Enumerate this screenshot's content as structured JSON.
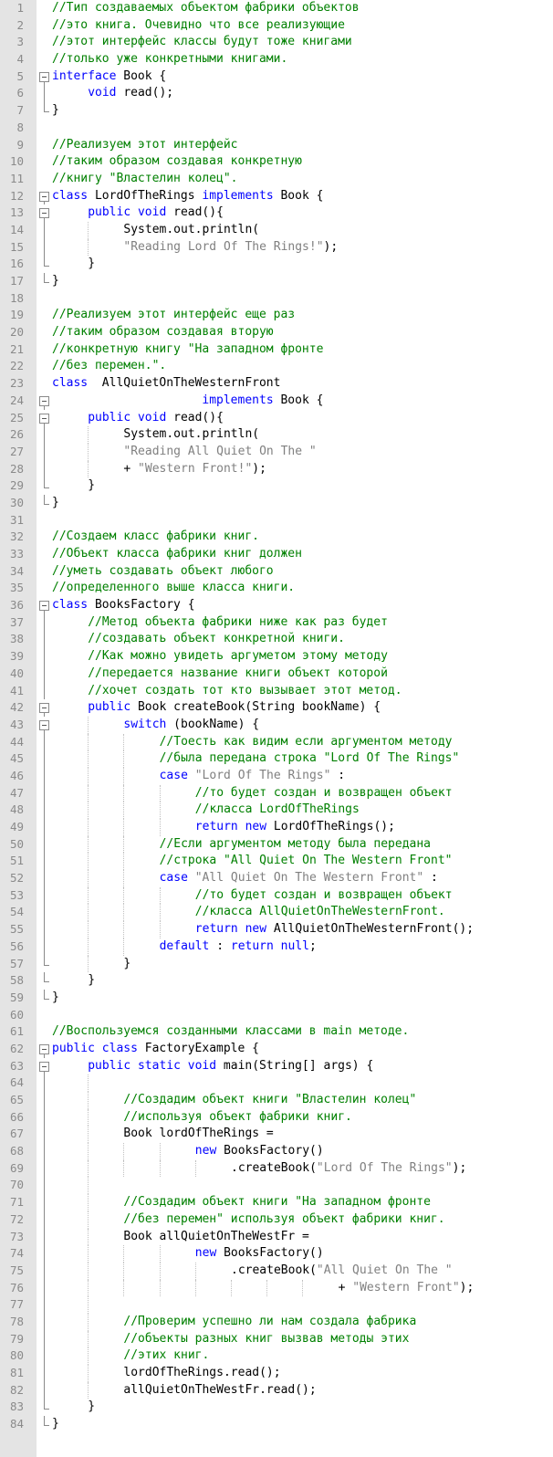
{
  "colors": {
    "comment": "#008000",
    "keyword": "#0000ff",
    "type": "#8000ff",
    "string": "#808080",
    "plain": "#000000",
    "line_number": "#8a8a8a",
    "gutter_background": "#e4e4e4"
  },
  "lines": [
    {
      "n": "1",
      "indent": 0,
      "fold": "none",
      "tokens": [
        [
          "comment",
          "//Тип создаваемых объектом фабрики объектов"
        ]
      ]
    },
    {
      "n": "2",
      "indent": 0,
      "fold": "none",
      "tokens": [
        [
          "comment",
          "//это книга. Очевидно что все реализующие"
        ]
      ]
    },
    {
      "n": "3",
      "indent": 0,
      "fold": "none",
      "tokens": [
        [
          "comment",
          "//этот интерфейс классы будут тоже книгами"
        ]
      ]
    },
    {
      "n": "4",
      "indent": 0,
      "fold": "none",
      "tokens": [
        [
          "comment",
          "//только уже конкретными книгами."
        ]
      ]
    },
    {
      "n": "5",
      "indent": 0,
      "fold": "open",
      "tokens": [
        [
          "keyword",
          "interface"
        ],
        [
          "plain",
          " Book {"
        ]
      ]
    },
    {
      "n": "6",
      "indent": 1,
      "fold": "mid",
      "tokens": [
        [
          "keyword",
          "void"
        ],
        [
          "plain",
          " read();"
        ]
      ]
    },
    {
      "n": "7",
      "indent": 0,
      "fold": "close",
      "tokens": [
        [
          "plain",
          "}"
        ]
      ]
    },
    {
      "n": "8",
      "indent": 0,
      "fold": "none",
      "tokens": []
    },
    {
      "n": "9",
      "indent": 0,
      "fold": "none",
      "tokens": [
        [
          "comment",
          "//Реализуем этот интерфейс"
        ]
      ]
    },
    {
      "n": "10",
      "indent": 0,
      "fold": "none",
      "tokens": [
        [
          "comment",
          "//таким образом создавая конкретную"
        ]
      ]
    },
    {
      "n": "11",
      "indent": 0,
      "fold": "none",
      "tokens": [
        [
          "comment",
          "//книгу \"Властелин колец\"."
        ]
      ]
    },
    {
      "n": "12",
      "indent": 0,
      "fold": "open",
      "tokens": [
        [
          "keyword",
          "class"
        ],
        [
          "plain",
          " LordOfTheRings "
        ],
        [
          "keyword",
          "implements"
        ],
        [
          "plain",
          " Book {"
        ]
      ]
    },
    {
      "n": "13",
      "indent": 1,
      "fold": "open",
      "tokens": [
        [
          "keyword",
          "public"
        ],
        [
          "plain",
          " "
        ],
        [
          "keyword",
          "void"
        ],
        [
          "plain",
          " read(){"
        ]
      ]
    },
    {
      "n": "14",
      "indent": 2,
      "fold": "mid",
      "tokens": [
        [
          "plain",
          "System.out.println("
        ]
      ]
    },
    {
      "n": "15",
      "indent": 2,
      "fold": "mid",
      "tokens": [
        [
          "string",
          "\"Reading Lord Of The Rings!\""
        ],
        [
          "plain",
          ");"
        ]
      ]
    },
    {
      "n": "16",
      "indent": 1,
      "fold": "close",
      "tokens": [
        [
          "plain",
          "}"
        ]
      ]
    },
    {
      "n": "17",
      "indent": 0,
      "fold": "close",
      "tokens": [
        [
          "plain",
          "}"
        ]
      ]
    },
    {
      "n": "18",
      "indent": 0,
      "fold": "none",
      "tokens": []
    },
    {
      "n": "19",
      "indent": 0,
      "fold": "none",
      "tokens": [
        [
          "comment",
          "//Реализуем этот интерфейс еще раз"
        ]
      ]
    },
    {
      "n": "20",
      "indent": 0,
      "fold": "none",
      "tokens": [
        [
          "comment",
          "//таким образом создавая вторую"
        ]
      ]
    },
    {
      "n": "21",
      "indent": 0,
      "fold": "none",
      "tokens": [
        [
          "comment",
          "//конкретную книгу \"На западном фронте"
        ]
      ]
    },
    {
      "n": "22",
      "indent": 0,
      "fold": "none",
      "tokens": [
        [
          "comment",
          "//без перемен.\"."
        ]
      ]
    },
    {
      "n": "23",
      "indent": 0,
      "fold": "none",
      "tokens": [
        [
          "keyword",
          "class"
        ],
        [
          "plain",
          "  AllQuietOnTheWesternFront"
        ]
      ]
    },
    {
      "n": "24",
      "indent": 0,
      "fold": "open",
      "tokens": [
        [
          "plain",
          "                     "
        ],
        [
          "keyword",
          "implements"
        ],
        [
          "plain",
          " Book {"
        ]
      ]
    },
    {
      "n": "25",
      "indent": 1,
      "fold": "open",
      "tokens": [
        [
          "keyword",
          "public"
        ],
        [
          "plain",
          " "
        ],
        [
          "keyword",
          "void"
        ],
        [
          "plain",
          " read(){"
        ]
      ]
    },
    {
      "n": "26",
      "indent": 2,
      "fold": "mid",
      "tokens": [
        [
          "plain",
          "System.out.println("
        ]
      ]
    },
    {
      "n": "27",
      "indent": 2,
      "fold": "mid",
      "tokens": [
        [
          "string",
          "\"Reading All Quiet On The \""
        ]
      ]
    },
    {
      "n": "28",
      "indent": 2,
      "fold": "mid",
      "tokens": [
        [
          "plain",
          "+ "
        ],
        [
          "string",
          "\"Western Front!\""
        ],
        [
          "plain",
          ");"
        ]
      ]
    },
    {
      "n": "29",
      "indent": 1,
      "fold": "close",
      "tokens": [
        [
          "plain",
          "}"
        ]
      ]
    },
    {
      "n": "30",
      "indent": 0,
      "fold": "close",
      "tokens": [
        [
          "plain",
          "}"
        ]
      ]
    },
    {
      "n": "31",
      "indent": 0,
      "fold": "none",
      "tokens": []
    },
    {
      "n": "32",
      "indent": 0,
      "fold": "none",
      "tokens": [
        [
          "comment",
          "//Создаем класс фабрики книг."
        ]
      ]
    },
    {
      "n": "33",
      "indent": 0,
      "fold": "none",
      "tokens": [
        [
          "comment",
          "//Объект класса фабрики книг должен"
        ]
      ]
    },
    {
      "n": "34",
      "indent": 0,
      "fold": "none",
      "tokens": [
        [
          "comment",
          "//уметь создавать объект любого"
        ]
      ]
    },
    {
      "n": "35",
      "indent": 0,
      "fold": "none",
      "tokens": [
        [
          "comment",
          "//определенного выше класса книги."
        ]
      ]
    },
    {
      "n": "36",
      "indent": 0,
      "fold": "open",
      "tokens": [
        [
          "keyword",
          "class"
        ],
        [
          "plain",
          " BooksFactory {"
        ]
      ]
    },
    {
      "n": "37",
      "indent": 1,
      "fold": "mid",
      "tokens": [
        [
          "comment",
          "//Метод объекта фабрики ниже как раз будет"
        ]
      ]
    },
    {
      "n": "38",
      "indent": 1,
      "fold": "mid",
      "tokens": [
        [
          "comment",
          "//создавать объект конкретной книги."
        ]
      ]
    },
    {
      "n": "39",
      "indent": 1,
      "fold": "mid",
      "tokens": [
        [
          "comment",
          "//Как можно увидеть аргуметом этому методу"
        ]
      ]
    },
    {
      "n": "40",
      "indent": 1,
      "fold": "mid",
      "tokens": [
        [
          "comment",
          "//передается название книги объект которой"
        ]
      ]
    },
    {
      "n": "41",
      "indent": 1,
      "fold": "mid",
      "tokens": [
        [
          "comment",
          "//хочет создать тот кто вызывает этот метод."
        ]
      ]
    },
    {
      "n": "42",
      "indent": 1,
      "fold": "open",
      "tokens": [
        [
          "keyword",
          "public"
        ],
        [
          "plain",
          " Book createBook(String bookName) {"
        ]
      ]
    },
    {
      "n": "43",
      "indent": 2,
      "fold": "open",
      "tokens": [
        [
          "keyword",
          "switch"
        ],
        [
          "plain",
          " (bookName) {"
        ]
      ]
    },
    {
      "n": "44",
      "indent": 3,
      "fold": "mid",
      "tokens": [
        [
          "comment",
          "//Тоесть как видим если аргументом методу"
        ]
      ]
    },
    {
      "n": "45",
      "indent": 3,
      "fold": "mid",
      "tokens": [
        [
          "comment",
          "//была передана строка \"Lord Of The Rings\""
        ]
      ]
    },
    {
      "n": "46",
      "indent": 3,
      "fold": "mid",
      "tokens": [
        [
          "keyword",
          "case"
        ],
        [
          "plain",
          " "
        ],
        [
          "string",
          "\"Lord Of The Rings\""
        ],
        [
          "plain",
          " :"
        ]
      ]
    },
    {
      "n": "47",
      "indent": 4,
      "fold": "mid",
      "tokens": [
        [
          "comment",
          "//то будет создан и возвращен объект"
        ]
      ]
    },
    {
      "n": "48",
      "indent": 4,
      "fold": "mid",
      "tokens": [
        [
          "comment",
          "//класса LordOfTheRings"
        ]
      ]
    },
    {
      "n": "49",
      "indent": 4,
      "fold": "mid",
      "tokens": [
        [
          "keyword",
          "return"
        ],
        [
          "plain",
          " "
        ],
        [
          "keyword",
          "new"
        ],
        [
          "plain",
          " LordOfTheRings();"
        ]
      ]
    },
    {
      "n": "50",
      "indent": 3,
      "fold": "mid",
      "tokens": [
        [
          "comment",
          "//Если аргументом методу была передана"
        ]
      ]
    },
    {
      "n": "51",
      "indent": 3,
      "fold": "mid",
      "tokens": [
        [
          "comment",
          "//строка \"All Quiet On The Western Front\""
        ]
      ]
    },
    {
      "n": "52",
      "indent": 3,
      "fold": "mid",
      "tokens": [
        [
          "keyword",
          "case"
        ],
        [
          "plain",
          " "
        ],
        [
          "string",
          "\"All Quiet On The Western Front\""
        ],
        [
          "plain",
          " :"
        ]
      ]
    },
    {
      "n": "53",
      "indent": 4,
      "fold": "mid",
      "tokens": [
        [
          "comment",
          "//то будет создан и возвращен объект"
        ]
      ]
    },
    {
      "n": "54",
      "indent": 4,
      "fold": "mid",
      "tokens": [
        [
          "comment",
          "//класса AllQuietOnTheWesternFront."
        ]
      ]
    },
    {
      "n": "55",
      "indent": 4,
      "fold": "mid",
      "tokens": [
        [
          "keyword",
          "return"
        ],
        [
          "plain",
          " "
        ],
        [
          "keyword",
          "new"
        ],
        [
          "plain",
          " AllQuietOnTheWesternFront();"
        ]
      ]
    },
    {
      "n": "56",
      "indent": 3,
      "fold": "mid",
      "tokens": [
        [
          "keyword",
          "default"
        ],
        [
          "plain",
          " : "
        ],
        [
          "keyword",
          "return"
        ],
        [
          "plain",
          " "
        ],
        [
          "keyword",
          "null"
        ],
        [
          "plain",
          ";"
        ]
      ]
    },
    {
      "n": "57",
      "indent": 2,
      "fold": "close",
      "tokens": [
        [
          "plain",
          "}"
        ]
      ]
    },
    {
      "n": "58",
      "indent": 1,
      "fold": "close",
      "tokens": [
        [
          "plain",
          "}"
        ]
      ]
    },
    {
      "n": "59",
      "indent": 0,
      "fold": "close",
      "tokens": [
        [
          "plain",
          "}"
        ]
      ]
    },
    {
      "n": "60",
      "indent": 0,
      "fold": "none",
      "tokens": []
    },
    {
      "n": "61",
      "indent": 0,
      "fold": "none",
      "tokens": [
        [
          "comment",
          "//Воспользуемся созданными классами в main методе."
        ]
      ]
    },
    {
      "n": "62",
      "indent": 0,
      "fold": "open",
      "tokens": [
        [
          "keyword",
          "public"
        ],
        [
          "plain",
          " "
        ],
        [
          "keyword",
          "class"
        ],
        [
          "plain",
          " FactoryExample {"
        ]
      ]
    },
    {
      "n": "63",
      "indent": 1,
      "fold": "open",
      "tokens": [
        [
          "keyword",
          "public"
        ],
        [
          "plain",
          " "
        ],
        [
          "keyword",
          "static"
        ],
        [
          "plain",
          " "
        ],
        [
          "keyword",
          "void"
        ],
        [
          "plain",
          " main(String[] args) {"
        ]
      ]
    },
    {
      "n": "64",
      "indent": 2,
      "fold": "mid",
      "tokens": []
    },
    {
      "n": "65",
      "indent": 2,
      "fold": "mid",
      "tokens": [
        [
          "comment",
          "//Создадим объект книги \"Властелин колец\""
        ]
      ]
    },
    {
      "n": "66",
      "indent": 2,
      "fold": "mid",
      "tokens": [
        [
          "comment",
          "//используя объект фабрики книг."
        ]
      ]
    },
    {
      "n": "67",
      "indent": 2,
      "fold": "mid",
      "tokens": [
        [
          "plain",
          "Book lordOfTheRings ="
        ]
      ]
    },
    {
      "n": "68",
      "indent": 4,
      "fold": "mid",
      "tokens": [
        [
          "keyword",
          "new"
        ],
        [
          "plain",
          " BooksFactory()"
        ]
      ]
    },
    {
      "n": "69",
      "indent": 5,
      "fold": "mid",
      "tokens": [
        [
          "plain",
          ".createBook("
        ],
        [
          "string",
          "\"Lord Of The Rings\""
        ],
        [
          "plain",
          ");"
        ]
      ]
    },
    {
      "n": "70",
      "indent": 2,
      "fold": "mid",
      "tokens": []
    },
    {
      "n": "71",
      "indent": 2,
      "fold": "mid",
      "tokens": [
        [
          "comment",
          "//Создадим объект книги \"На западном фронте"
        ]
      ]
    },
    {
      "n": "72",
      "indent": 2,
      "fold": "mid",
      "tokens": [
        [
          "comment",
          "//без перемен\" используя объект фабрики книг."
        ]
      ]
    },
    {
      "n": "73",
      "indent": 2,
      "fold": "mid",
      "tokens": [
        [
          "plain",
          "Book allQuietOnTheWestFr ="
        ]
      ]
    },
    {
      "n": "74",
      "indent": 4,
      "fold": "mid",
      "tokens": [
        [
          "keyword",
          "new"
        ],
        [
          "plain",
          " BooksFactory()"
        ]
      ]
    },
    {
      "n": "75",
      "indent": 5,
      "fold": "mid",
      "tokens": [
        [
          "plain",
          ".createBook("
        ],
        [
          "string",
          "\"All Quiet On The \""
        ]
      ]
    },
    {
      "n": "76",
      "indent": 8,
      "fold": "mid",
      "tokens": [
        [
          "plain",
          "+ "
        ],
        [
          "string",
          "\"Western Front\""
        ],
        [
          "plain",
          ");"
        ]
      ]
    },
    {
      "n": "77",
      "indent": 2,
      "fold": "mid",
      "tokens": []
    },
    {
      "n": "78",
      "indent": 2,
      "fold": "mid",
      "tokens": [
        [
          "comment",
          "//Проверим успешно ли нам создала фабрика"
        ]
      ]
    },
    {
      "n": "79",
      "indent": 2,
      "fold": "mid",
      "tokens": [
        [
          "comment",
          "//объекты разных книг вызвав методы этих"
        ]
      ]
    },
    {
      "n": "80",
      "indent": 2,
      "fold": "mid",
      "tokens": [
        [
          "comment",
          "//этих книг."
        ]
      ]
    },
    {
      "n": "81",
      "indent": 2,
      "fold": "mid",
      "tokens": [
        [
          "plain",
          "lordOfTheRings.read();"
        ]
      ]
    },
    {
      "n": "82",
      "indent": 2,
      "fold": "mid",
      "tokens": [
        [
          "plain",
          "allQuietOnTheWestFr.read();"
        ]
      ]
    },
    {
      "n": "83",
      "indent": 1,
      "fold": "close",
      "tokens": [
        [
          "plain",
          "}"
        ]
      ]
    },
    {
      "n": "84",
      "indent": 0,
      "fold": "close",
      "tokens": [
        [
          "plain",
          "}"
        ]
      ]
    }
  ]
}
